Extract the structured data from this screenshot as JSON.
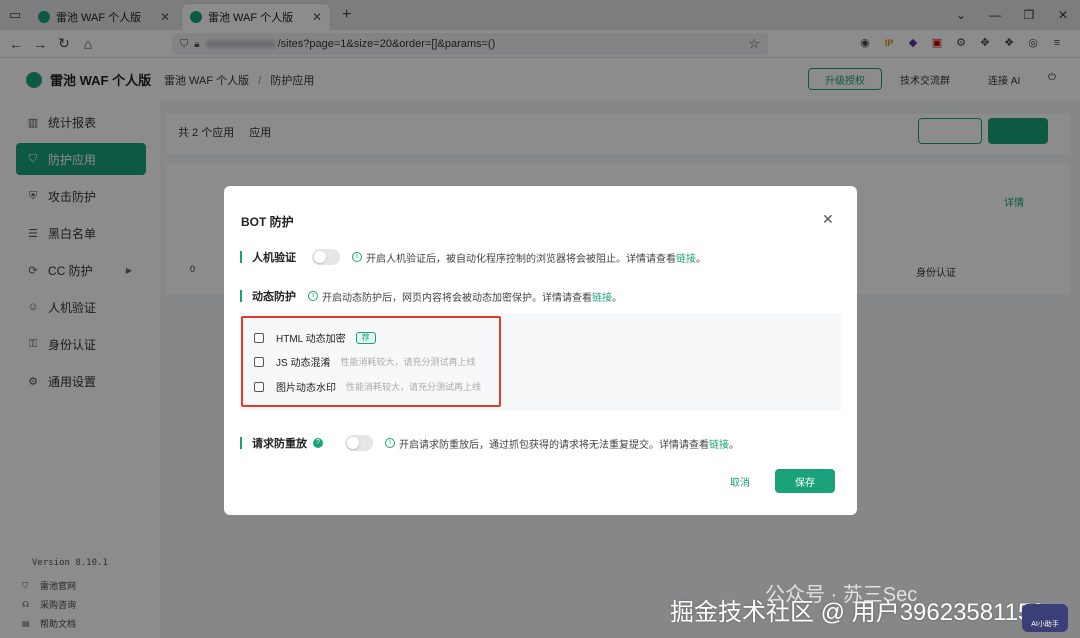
{
  "browser": {
    "tabs": [
      {
        "title": "雷池 WAF 个人版",
        "active": false
      },
      {
        "title": "雷池 WAF 个人版",
        "active": true
      }
    ],
    "url": "/sites?page=1&size=20&order=[]&params=()"
  },
  "sidebar": {
    "brand": "雷池 WAF 个人版",
    "items": [
      {
        "label": "统计报表",
        "icon": "bar-chart-icon"
      },
      {
        "label": "防护应用",
        "icon": "shield-icon",
        "active": true
      },
      {
        "label": "攻击防护",
        "icon": "attack-icon"
      },
      {
        "label": "黑白名单",
        "icon": "list-icon"
      },
      {
        "label": "CC 防护",
        "icon": "cc-icon",
        "expandable": true
      },
      {
        "label": "人机验证",
        "icon": "robot-icon"
      },
      {
        "label": "身份认证",
        "icon": "id-icon"
      },
      {
        "label": "通用设置",
        "icon": "settings-icon"
      }
    ],
    "version": "Version 8.10.1",
    "footer": [
      {
        "label": "雷池官网"
      },
      {
        "label": "采购咨询"
      },
      {
        "label": "帮助文档"
      }
    ]
  },
  "topbar": {
    "breadcrumb_root": "雷池 WAF 个人版",
    "breadcrumb_current": "防护应用",
    "upgrade": "升级授权",
    "community": "技术交流群",
    "connect_ai": "连接 AI"
  },
  "content": {
    "count_text": "共 2 个应用",
    "tab_label": "应用",
    "bg_detail": "详情",
    "bg_identity": "身份认证",
    "bg_zero": "0"
  },
  "modal": {
    "title": "BOT 防护",
    "sections": {
      "captcha": {
        "label": "人机验证",
        "desc": "开启人机验证后，被自动化程序控制的浏览器将会被阻止。详情请查看",
        "link": "链接",
        "end": "。"
      },
      "dynamic": {
        "label": "动态防护",
        "desc": "开启动态防护后，网页内容将会被动态加密保护。详情请查看",
        "link": "链接",
        "end": "。"
      },
      "replay": {
        "label": "请求防重放",
        "desc": "开启请求防重放后，通过抓包获得的请求将无法重复提交。详情请查看",
        "link": "链接",
        "end": "。"
      }
    },
    "options": [
      {
        "label": "HTML 动态加密",
        "badge": "荐",
        "hint": ""
      },
      {
        "label": "JS 动态混淆",
        "badge": "",
        "hint": "性能消耗较大，请充分测试再上线"
      },
      {
        "label": "图片动态水印",
        "badge": "",
        "hint": "性能消耗较大，请充分测试再上线"
      }
    ],
    "cancel": "取消",
    "save": "保存"
  },
  "watermark": {
    "wechat": "公众号 · 苏三Sec",
    "text": "掘金技术社区 @ 用户3962358115​3",
    "ai_badge": "AI小助手"
  },
  "colors": {
    "accent": "#1aa37a",
    "highlight": "#e23a2b"
  }
}
